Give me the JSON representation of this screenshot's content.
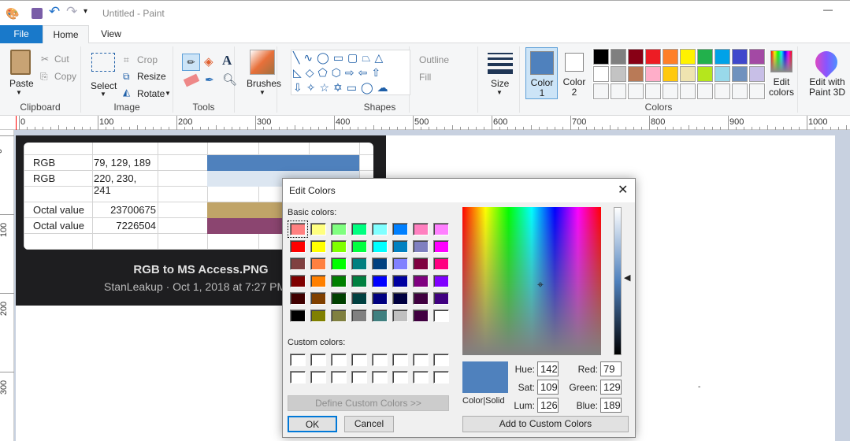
{
  "window": {
    "title": "Untitled - Paint"
  },
  "tabs": [
    "File",
    "Home",
    "View"
  ],
  "ribbon": {
    "clipboard": {
      "label": "Clipboard",
      "paste": "Paste",
      "cut": "Cut",
      "copy": "Copy"
    },
    "image": {
      "label": "Image",
      "select": "Select",
      "crop": "Crop",
      "resize": "Resize",
      "rotate": "Rotate"
    },
    "tools": {
      "label": "Tools"
    },
    "brushes": {
      "label": "Brushes"
    },
    "shapes": {
      "label": "Shapes",
      "outline": "Outline",
      "fill": "Fill"
    },
    "size": {
      "label": "Size"
    },
    "colors": {
      "label": "Colors",
      "color1": "Color",
      "color1n": "1",
      "color2": "Color",
      "color2n": "2",
      "edit1": "Edit",
      "edit2": "colors",
      "color1_value": "#4f81bd",
      "color2_value": "#ffffff",
      "palette": [
        "#000000",
        "#7f7f7f",
        "#880015",
        "#ed1c24",
        "#ff7f27",
        "#fff200",
        "#22b14c",
        "#00a2e8",
        "#3f48cc",
        "#a349a4",
        "#ffffff",
        "#c3c3c3",
        "#b97a57",
        "#ffaec9",
        "#ffc90e",
        "#efe4b0",
        "#b5e61d",
        "#99d9ea",
        "#7092be",
        "#c8bfe7"
      ]
    },
    "paint3d": {
      "l1": "Edit with",
      "l2": "Paint 3D"
    }
  },
  "ruler": {
    "h": [
      "0",
      "100",
      "200",
      "300",
      "400",
      "500",
      "600",
      "700",
      "800",
      "900",
      "1000"
    ],
    "v": [
      "0",
      "100",
      "200",
      "300"
    ]
  },
  "pasted": {
    "rows": [
      {
        "a": "RGB",
        "b": "79, 129, 189",
        "color": "#4f81bd"
      },
      {
        "a": "RGB",
        "b": "220, 230, 241",
        "color": "#dce6f1"
      },
      {
        "a": "",
        "b": "",
        "color": ""
      },
      {
        "a": "Octal value",
        "b": "23700675",
        "color": "#c0a468"
      },
      {
        "a": "Octal value",
        "b": "7226504",
        "color": "#8b4570"
      }
    ],
    "caption": "RGB to MS Access.PNG",
    "byline": "StanLeakup · Oct 1, 2018 at 7:27 PM"
  },
  "dialog": {
    "title": "Edit Colors",
    "basic_label": "Basic colors:",
    "custom_label": "Custom colors:",
    "basic": [
      "#ff8080",
      "#ffff80",
      "#80ff80",
      "#00ff80",
      "#80ffff",
      "#0080ff",
      "#ff80c0",
      "#ff80ff",
      "#ff0000",
      "#ffff00",
      "#80ff00",
      "#00ff40",
      "#00ffff",
      "#0080c0",
      "#8080c0",
      "#ff00ff",
      "#804040",
      "#ff8040",
      "#00ff00",
      "#008080",
      "#004080",
      "#8080ff",
      "#800040",
      "#ff0080",
      "#800000",
      "#ff8000",
      "#008000",
      "#008040",
      "#0000ff",
      "#0000a0",
      "#800080",
      "#8000ff",
      "#400000",
      "#804000",
      "#004000",
      "#004040",
      "#000080",
      "#000040",
      "#400040",
      "#400080",
      "#000000",
      "#808000",
      "#808040",
      "#808080",
      "#408080",
      "#c0c0c0",
      "#400040",
      "#ffffff"
    ],
    "define": "Define Custom Colors >>",
    "ok": "OK",
    "cancel": "Cancel",
    "preview_label": "Color|Solid",
    "preview_color": "#4f81bd",
    "hue_label": "Hue:",
    "sat_label": "Sat:",
    "lum_label": "Lum:",
    "red_label": "Red:",
    "green_label": "Green:",
    "blue_label": "Blue:",
    "hue": "142",
    "sat": "109",
    "lum": "126",
    "red": "79",
    "green": "129",
    "blue": "189",
    "add": "Add to Custom Colors"
  }
}
